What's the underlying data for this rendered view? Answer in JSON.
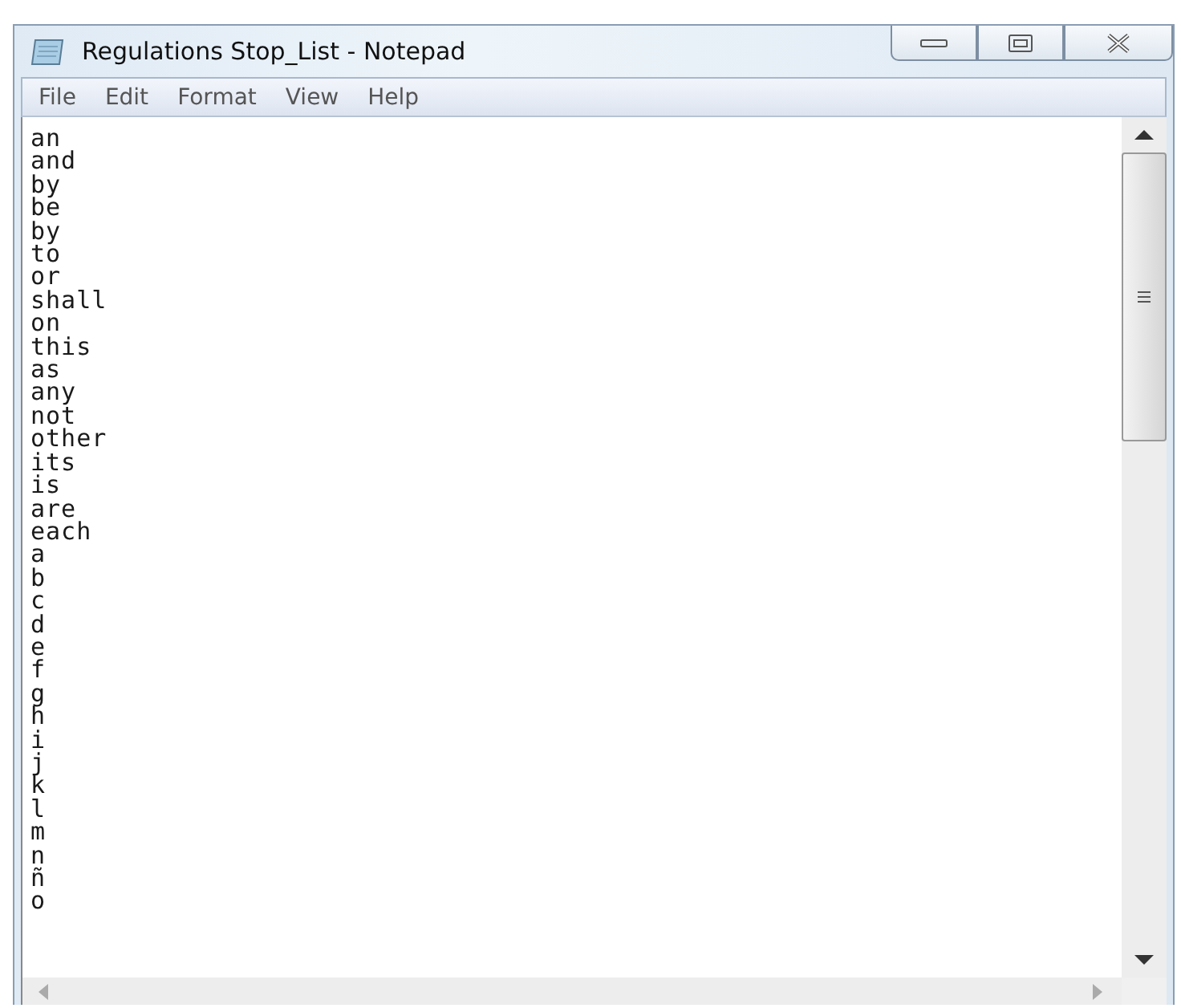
{
  "window": {
    "title": "Regulations Stop_List - Notepad"
  },
  "menu": [
    "File",
    "Edit",
    "Format",
    "View",
    "Help"
  ],
  "lines": [
    "an",
    "and",
    "by",
    "be",
    "by",
    "to",
    "or",
    "shall",
    "on",
    "this",
    "as",
    "any",
    "not",
    "other",
    "its",
    "is",
    "are",
    "each",
    "a",
    "b",
    "c",
    "d",
    "e",
    "f",
    "g",
    "h",
    "i",
    "j",
    "k",
    "l",
    "m",
    "n",
    "ñ",
    "o"
  ]
}
